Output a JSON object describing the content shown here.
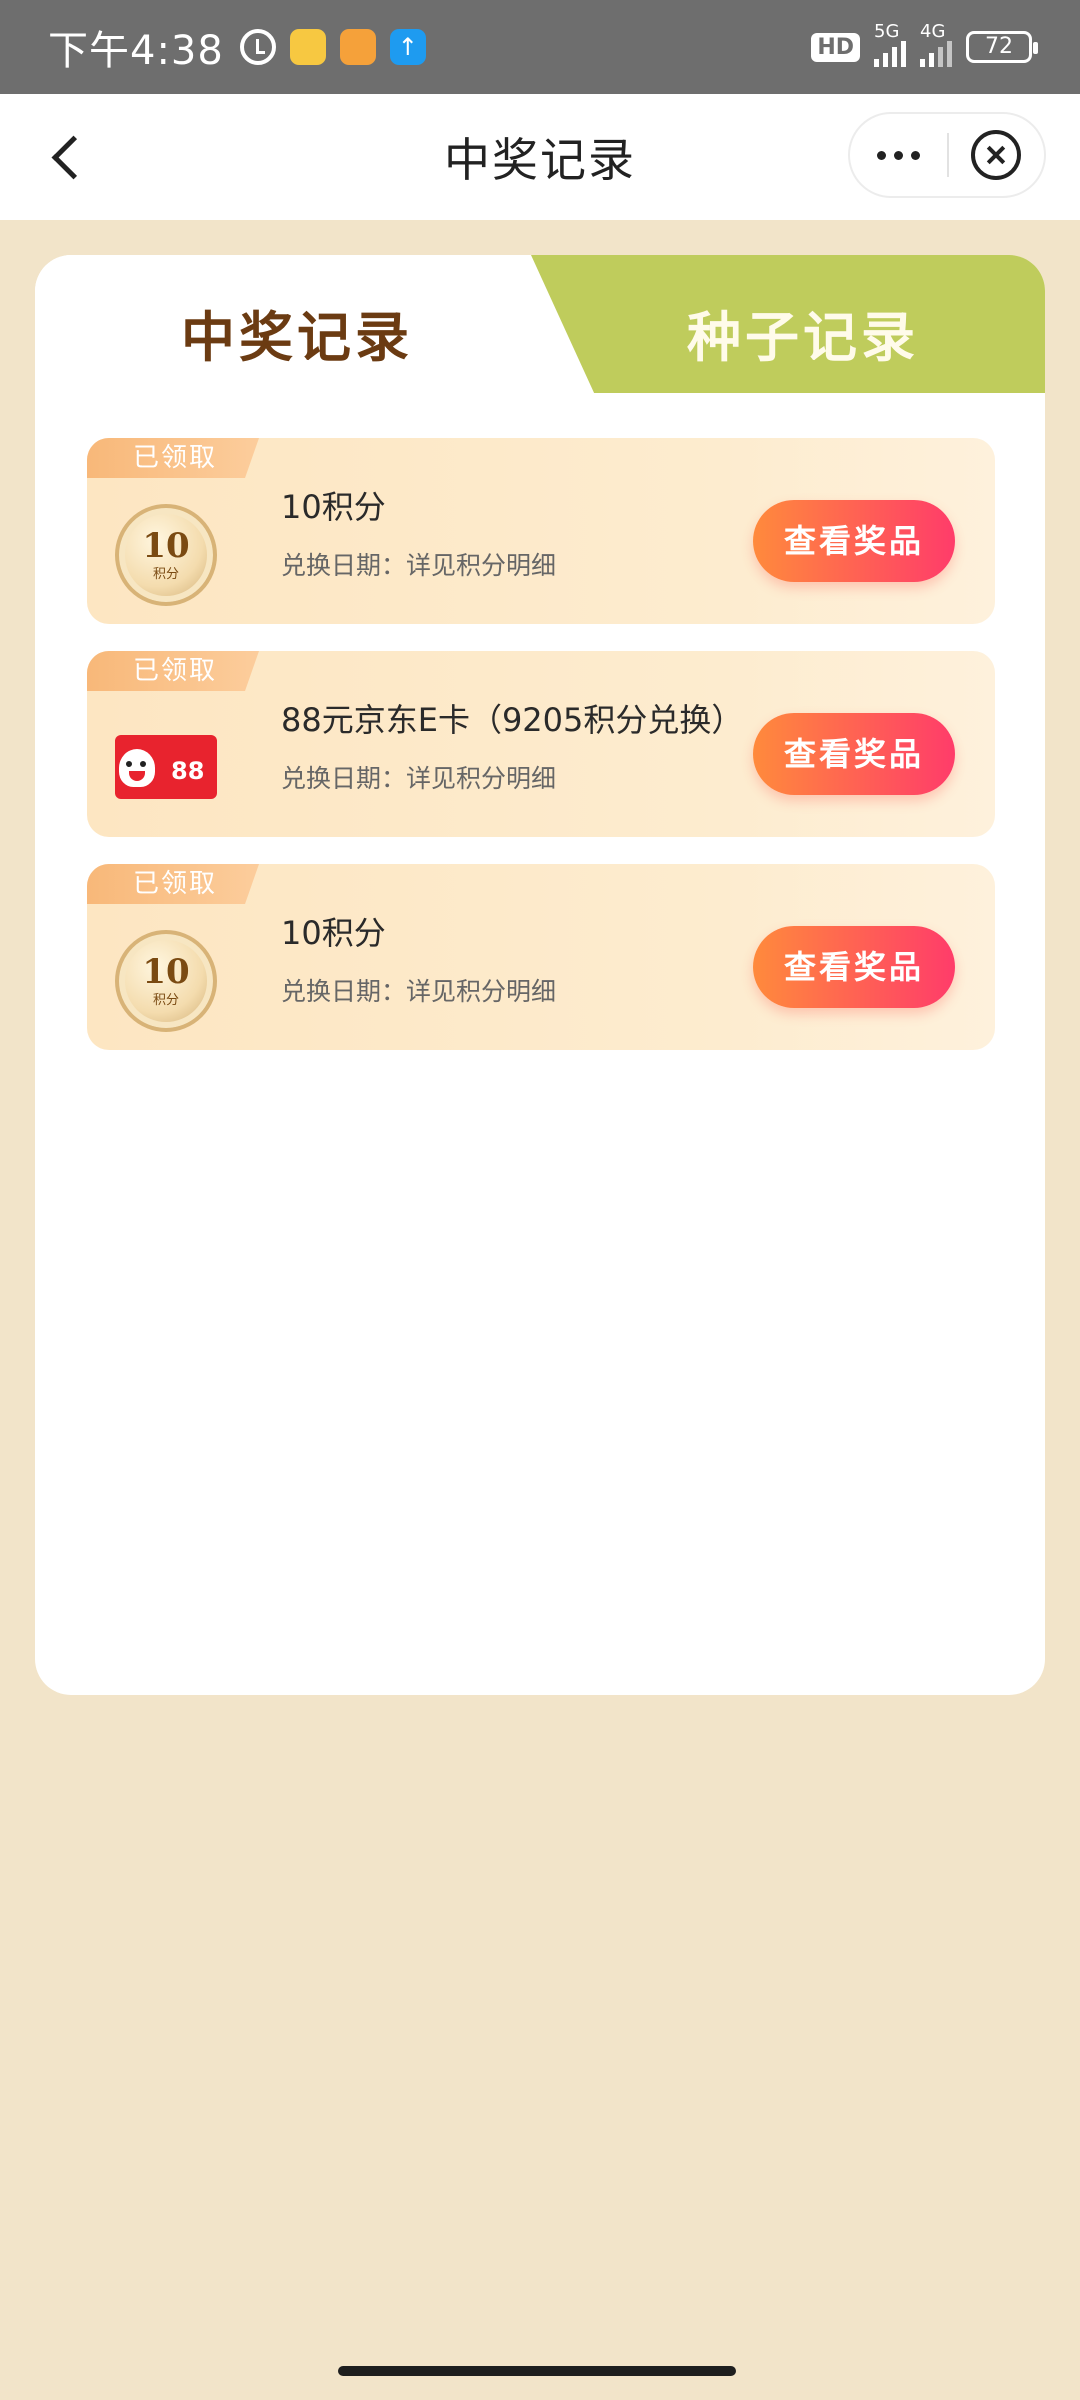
{
  "status_bar": {
    "time": "下午4:38",
    "hd_label": "HD",
    "net1_label": "5G",
    "net2_label": "4G",
    "battery": "72"
  },
  "nav": {
    "title": "中奖记录"
  },
  "tabs": [
    {
      "label": "中奖记录",
      "active": true
    },
    {
      "label": "种子记录",
      "active": false
    }
  ],
  "records": [
    {
      "badge": "已领取",
      "icon": "points-coin-icon",
      "coin_number": "10",
      "coin_text": "积分",
      "title": "10积分",
      "date": "兑换日期：详见积分明细",
      "button": "查看奖品"
    },
    {
      "badge": "已领取",
      "icon": "jd-ecard-icon",
      "card_value": "88",
      "title": "88元京东E卡（9205积分兑换）",
      "date": "兑换日期：详见积分明细",
      "button": "查看奖品"
    },
    {
      "badge": "已领取",
      "icon": "points-coin-icon",
      "coin_number": "10",
      "coin_text": "积分",
      "title": "10积分",
      "date": "兑换日期：详见积分明细",
      "button": "查看奖品"
    }
  ],
  "colors": {
    "page_bg": "#f2e4c9",
    "tab_green": "#bfcc5c",
    "active_tab_text": "#6b3b12",
    "button_gradient_start": "#ff8a3c",
    "button_gradient_end": "#ff3c6a"
  }
}
